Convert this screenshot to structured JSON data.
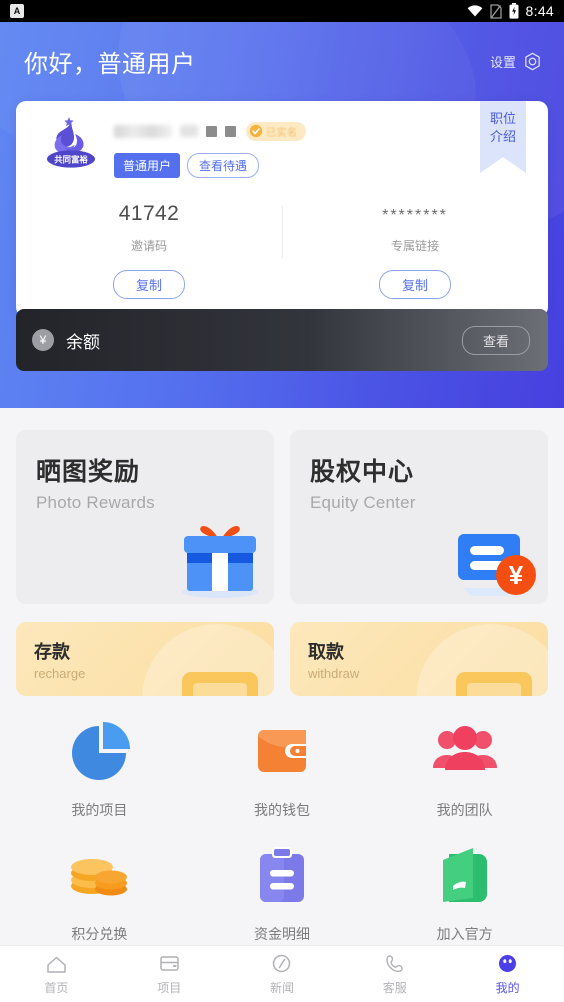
{
  "statusbar": {
    "app_icon": "A",
    "time": "8:44",
    "icons": [
      "wifi-icon",
      "no-sim-icon",
      "battery-charging-icon"
    ]
  },
  "header": {
    "greeting": "你好，普通用户",
    "settings_label": "设置",
    "settings_icon": "gear-icon",
    "gradient_from": "#5f87f2",
    "gradient_to": "#4740df"
  },
  "profile": {
    "ribbon": {
      "line1": "职位",
      "line2": "介绍"
    },
    "logo_text": "共同富裕",
    "verified_badge": "已实名",
    "tag_primary": "普通用户",
    "tag_secondary": "查看待遇",
    "invite": {
      "value": "41742",
      "label": "邀请码",
      "copy_label": "复制"
    },
    "link": {
      "value": "********",
      "label": "专属链接",
      "copy_label": "复制"
    }
  },
  "balance": {
    "currency_symbol": "¥",
    "label": "余额",
    "view_label": "查看"
  },
  "features": [
    {
      "title_cn": "晒图奖励",
      "title_en": "Photo Rewards",
      "icon": "gift-box-icon"
    },
    {
      "title_cn": "股权中心",
      "title_en": "Equity Center",
      "icon": "equity-card-icon"
    }
  ],
  "money_actions": [
    {
      "title_cn": "存款",
      "title_en": "recharge",
      "icon": "deposit-slot-icon"
    },
    {
      "title_cn": "取款",
      "title_en": "withdraw",
      "icon": "withdraw-slot-icon"
    }
  ],
  "grid": [
    [
      {
        "label": "我的项目",
        "icon": "pie-chart-icon"
      },
      {
        "label": "我的钱包",
        "icon": "wallet-icon"
      },
      {
        "label": "我的团队",
        "icon": "team-icon"
      }
    ],
    [
      {
        "label": "积分兑换",
        "icon": "coins-icon"
      },
      {
        "label": "资金明细",
        "icon": "clipboard-icon"
      },
      {
        "label": "加入官方",
        "icon": "green-book-icon"
      }
    ]
  ],
  "tabbar": {
    "active_color": "#5a55ea",
    "items": [
      {
        "label": "首页",
        "icon": "home-icon",
        "active": false
      },
      {
        "label": "项目",
        "icon": "card-icon",
        "active": false
      },
      {
        "label": "新闻",
        "icon": "compass-icon",
        "active": false
      },
      {
        "label": "客服",
        "icon": "phone-icon",
        "active": false
      },
      {
        "label": "我的",
        "icon": "user-avatar-icon",
        "active": true
      }
    ]
  }
}
